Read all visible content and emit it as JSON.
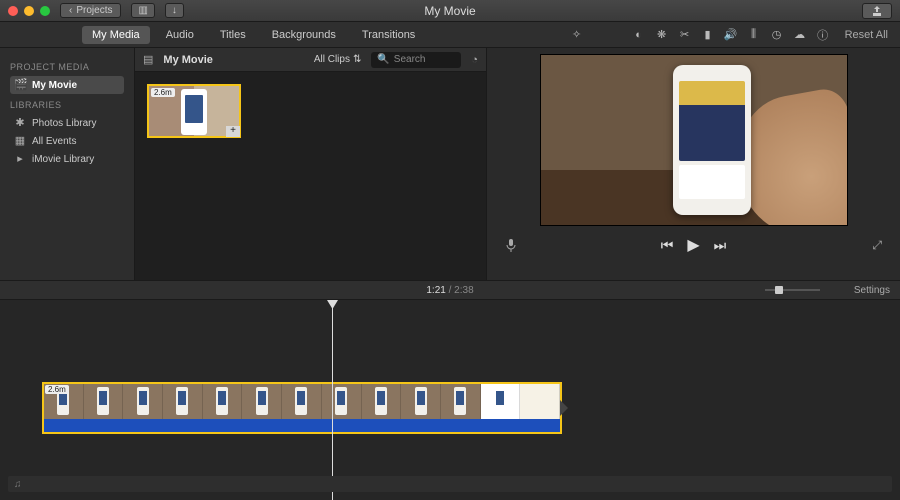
{
  "titlebar": {
    "back_label": "Projects",
    "title": "My Movie"
  },
  "tabs": {
    "items": [
      "My Media",
      "Audio",
      "Titles",
      "Backgrounds",
      "Transitions"
    ],
    "active_index": 0
  },
  "toolbar_right": {
    "reset_label": "Reset All"
  },
  "sidebar": {
    "header_project": "PROJECT MEDIA",
    "project_item": "My Movie",
    "header_libraries": "LIBRARIES",
    "items": [
      {
        "label": "Photos Library",
        "icon": "✱"
      },
      {
        "label": "All Events",
        "icon": "▦"
      },
      {
        "label": "iMovie Library",
        "icon": "▸"
      }
    ]
  },
  "browser": {
    "project_name": "My Movie",
    "clips_label": "All Clips",
    "search_placeholder": "Search",
    "clip_badge": "2.6m"
  },
  "ruler": {
    "current": "1:21",
    "total": "2:38",
    "settings_label": "Settings"
  },
  "timeline": {
    "clip_badge": "2.6m",
    "music_icon": "♫"
  }
}
